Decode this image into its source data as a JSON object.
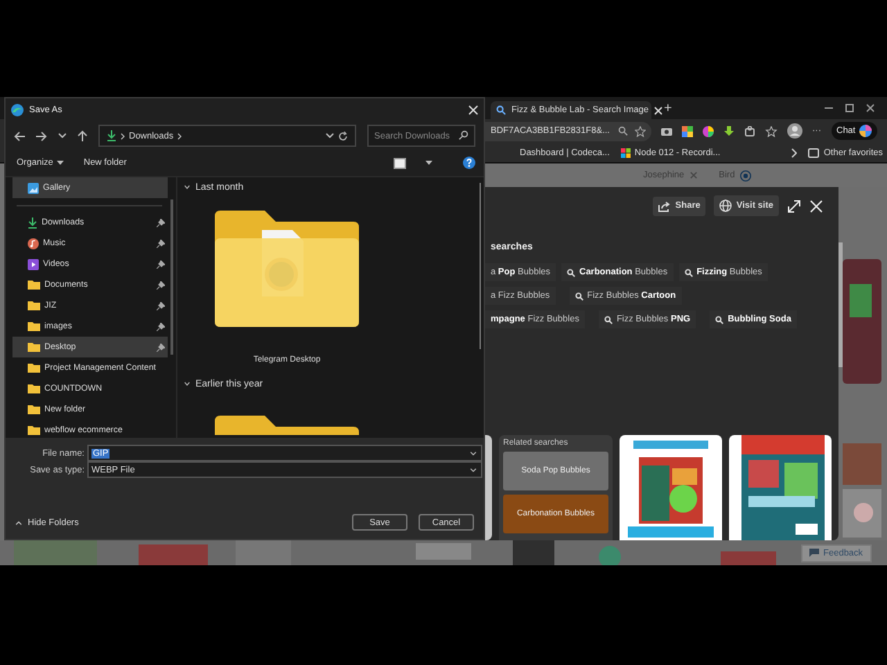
{
  "browser": {
    "tab": {
      "title": "Fizz & Bubble Lab - Search Image",
      "selected": true
    },
    "new_tab": "+",
    "address": "BDF7ACA3BB1FB2831F8&...",
    "more": "···",
    "chat": "Chat",
    "favorites": [
      {
        "label": "Dashboard | Codeca...",
        "kind": "plain"
      },
      {
        "label": "Node 012 - Recordi...",
        "kind": "windows"
      }
    ],
    "other_favorites": "Other favorites",
    "page": {
      "filters": [
        "Josephine",
        "Bird"
      ],
      "viewer": {
        "actions": [
          {
            "label": "Share",
            "kind": "share"
          },
          {
            "label": "Visit site",
            "kind": "globe"
          }
        ],
        "heading": "searches",
        "chip_rows": [
          [
            "a **Pop** Bubbles",
            "**Carbonation** Bubbles",
            "**Fizzing** Bubbles"
          ],
          [
            "a Fizz Bubbles",
            "Fizz Bubbles **Cartoon**"
          ],
          [
            "**mpagne** Fizz Bubbles",
            "Fizz Bubbles **PNG**",
            "**Bubbling Soda**"
          ]
        ],
        "related": {
          "title": "Related searches",
          "items": [
            {
              "label": "Soda Pop Bubbles",
              "kind": "grey"
            },
            {
              "label": "Carbonation Bubbles",
              "kind": "orange"
            }
          ]
        }
      },
      "feedback": "Feedback"
    }
  },
  "dialog": {
    "title": "Save As",
    "breadcrumb": "Downloads",
    "search_placeholder": "Search Downloads",
    "toolbar": [
      "Organize",
      "New folder"
    ],
    "quick": [
      {
        "label": "Gallery",
        "kind": "gallery",
        "pinned": false,
        "highlighted": true
      }
    ],
    "nav": [
      {
        "label": "Downloads",
        "kind": "download",
        "pinned": true,
        "highlighted": false
      },
      {
        "label": "Music",
        "kind": "music",
        "pinned": true,
        "highlighted": false
      },
      {
        "label": "Videos",
        "kind": "video",
        "pinned": true,
        "highlighted": false
      },
      {
        "label": "Documents",
        "kind": "folder",
        "pinned": true,
        "highlighted": false
      },
      {
        "label": "JIZ",
        "kind": "folder",
        "pinned": true,
        "highlighted": false
      },
      {
        "label": "images",
        "kind": "folder",
        "pinned": true,
        "highlighted": false
      },
      {
        "label": "Desktop",
        "kind": "folder",
        "pinned": true,
        "highlighted": true
      },
      {
        "label": "Project Management Content",
        "kind": "folder",
        "pinned": false,
        "highlighted": false
      },
      {
        "label": "COUNTDOWN",
        "kind": "folder",
        "pinned": false,
        "highlighted": false
      },
      {
        "label": "New folder",
        "kind": "folder",
        "pinned": false,
        "highlighted": false
      },
      {
        "label": "webflow ecommerce",
        "kind": "folder",
        "pinned": false,
        "highlighted": false
      }
    ],
    "groups": [
      {
        "title": "Last month",
        "expanded": true,
        "folders": [
          {
            "label": "Telegram Desktop",
            "kind": "app"
          }
        ]
      },
      {
        "title": "Earlier this year",
        "expanded": true,
        "folders": [
          {
            "kind": "plain"
          }
        ]
      }
    ],
    "file_name_label": "File name:",
    "file_name": "GIP",
    "file_name_selected": true,
    "type_label": "Save as type:",
    "save_as_type": "WEBP File",
    "hide_folders": "Hide Folders",
    "buttons": [
      "Save",
      "Cancel"
    ]
  }
}
